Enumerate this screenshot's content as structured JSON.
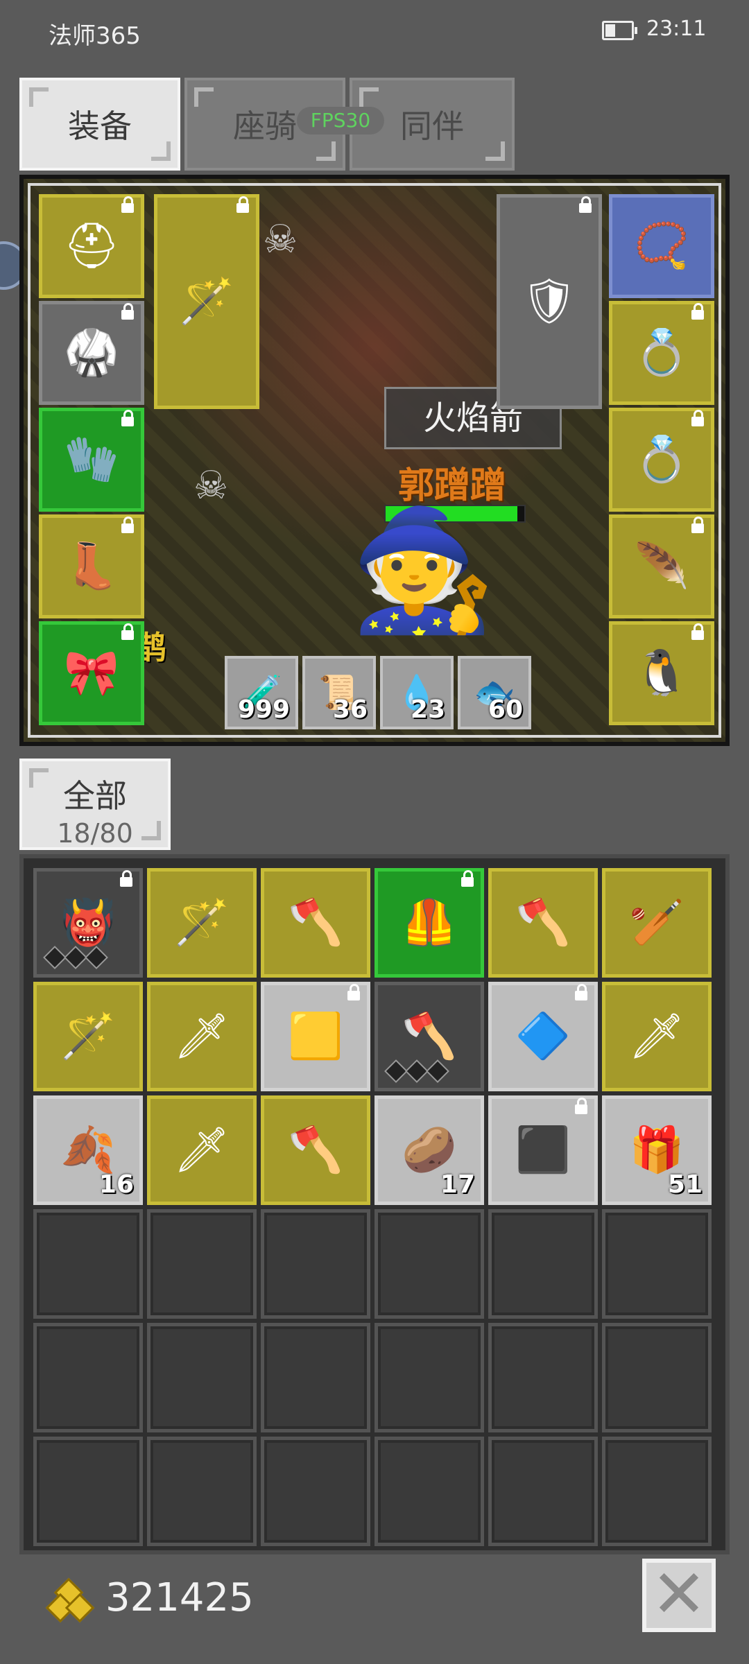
{
  "status": {
    "app_title": "法师365",
    "time": "23:11"
  },
  "tabs": [
    {
      "label": "装备",
      "active": true
    },
    {
      "label": "座骑",
      "active": false
    },
    {
      "label": "同伴",
      "active": false
    }
  ],
  "fps_label": "FPS30",
  "scene": {
    "spell_label": "火焰箭",
    "player_name": "郭蹭蹭",
    "pet_name": "鹊",
    "hp_fraction": 0.95
  },
  "equipment": {
    "left_column": [
      {
        "name": "helmet",
        "icon": "⛑",
        "color": "yellow",
        "locked": true
      },
      {
        "name": "armor",
        "icon": "🥋",
        "color": "gray",
        "locked": true
      },
      {
        "name": "gloves",
        "icon": "🧤",
        "color": "green",
        "locked": true
      },
      {
        "name": "boots",
        "icon": "👢",
        "color": "yellow",
        "locked": true
      },
      {
        "name": "belt",
        "icon": "🎀",
        "color": "green",
        "locked": true
      }
    ],
    "weapon": {
      "icon": "🪄",
      "color": "yellow",
      "locked": true
    },
    "offhand": {
      "icon": "🛡",
      "color": "gray",
      "locked": true
    },
    "right_column": [
      {
        "name": "necklace",
        "icon": "📿",
        "color": "blue",
        "locked": false
      },
      {
        "name": "ring-1",
        "icon": "💍",
        "color": "yellow",
        "locked": true
      },
      {
        "name": "ring-2",
        "icon": "💍",
        "color": "yellow",
        "locked": true
      },
      {
        "name": "wings",
        "icon": "🪶",
        "color": "yellow",
        "locked": true
      },
      {
        "name": "pet-card",
        "icon": "🐧",
        "color": "yellow",
        "locked": true
      }
    ]
  },
  "quickbar": [
    {
      "icon": "🧪",
      "count": "999"
    },
    {
      "icon": "📜",
      "count": "36"
    },
    {
      "icon": "💧",
      "count": "23"
    },
    {
      "icon": "🐟",
      "count": "60"
    }
  ],
  "inventory_filter": {
    "label": "全部",
    "capacity": "18/80"
  },
  "inventory": [
    {
      "icon": "👹",
      "color": "dark",
      "locked": true,
      "gems": 3,
      "count": ""
    },
    {
      "icon": "🪄",
      "color": "yellow",
      "locked": false,
      "gems": 0,
      "count": ""
    },
    {
      "icon": "🪓",
      "color": "yellow",
      "locked": false,
      "gems": 0,
      "count": ""
    },
    {
      "icon": "🦺",
      "color": "green",
      "locked": true,
      "gems": 0,
      "count": ""
    },
    {
      "icon": "🪓",
      "color": "yellow",
      "locked": false,
      "gems": 0,
      "count": ""
    },
    {
      "icon": "🏏",
      "color": "yellow",
      "locked": false,
      "gems": 0,
      "count": ""
    },
    {
      "icon": "🪄",
      "color": "yellow",
      "locked": false,
      "gems": 0,
      "count": ""
    },
    {
      "icon": "🗡",
      "color": "yellow",
      "locked": false,
      "gems": 0,
      "count": ""
    },
    {
      "icon": "🟨",
      "color": "light",
      "locked": true,
      "gems": 0,
      "count": ""
    },
    {
      "icon": "🪓",
      "color": "dark",
      "locked": false,
      "gems": 3,
      "count": ""
    },
    {
      "icon": "🔷",
      "color": "light",
      "locked": true,
      "gems": 0,
      "count": ""
    },
    {
      "icon": "🗡",
      "color": "yellow",
      "locked": false,
      "gems": 0,
      "count": ""
    },
    {
      "icon": "🍂",
      "color": "light",
      "locked": false,
      "gems": 0,
      "count": "16"
    },
    {
      "icon": "🗡",
      "color": "yellow",
      "locked": false,
      "gems": 0,
      "count": ""
    },
    {
      "icon": "🪓",
      "color": "yellow",
      "locked": false,
      "gems": 0,
      "count": ""
    },
    {
      "icon": "🥔",
      "color": "light",
      "locked": false,
      "gems": 0,
      "count": "17"
    },
    {
      "icon": "⬛",
      "color": "light",
      "locked": true,
      "gems": 0,
      "count": ""
    },
    {
      "icon": "🎁",
      "color": "light",
      "locked": false,
      "gems": 0,
      "count": "51"
    }
  ],
  "gold": "321425",
  "close_label": "✕"
}
